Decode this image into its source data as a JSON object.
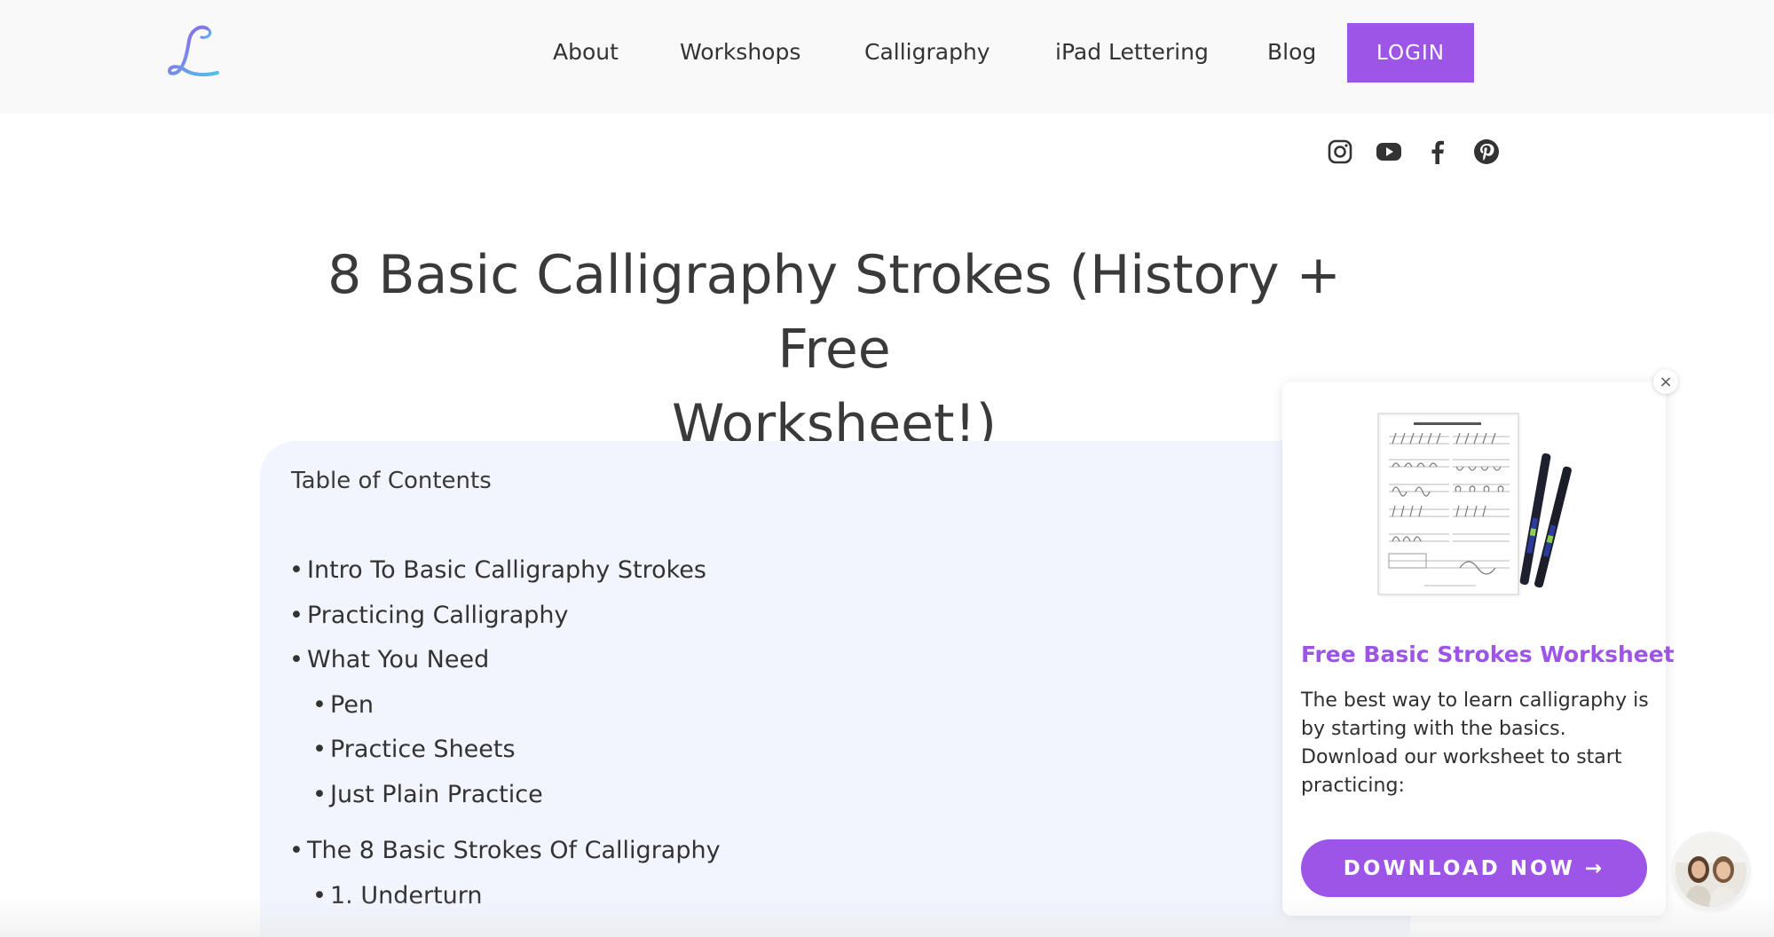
{
  "header": {
    "logo_letter": "L",
    "nav": [
      {
        "label": "About"
      },
      {
        "label": "Workshops"
      },
      {
        "label": "Calligraphy"
      },
      {
        "label": "iPad Lettering"
      },
      {
        "label": "Blog"
      }
    ],
    "login_label": "LOGIN"
  },
  "social": [
    {
      "icon": "instagram-icon"
    },
    {
      "icon": "youtube-icon"
    },
    {
      "icon": "facebook-icon"
    },
    {
      "icon": "pinterest-icon"
    }
  ],
  "article": {
    "title_line1": "8 Basic Calligraphy Strokes (History + Free",
    "title_line2": "Worksheet!)"
  },
  "toc": {
    "title": "Table of Contents",
    "items": [
      {
        "label": "Intro To Basic Calligraphy Strokes",
        "level": 1
      },
      {
        "label": "Practicing Calligraphy",
        "level": 1
      },
      {
        "label": "What You Need",
        "level": 1
      },
      {
        "label": "Pen",
        "level": 2
      },
      {
        "label": "Practice Sheets",
        "level": 2
      },
      {
        "label": "Just Plain Practice",
        "level": 2
      },
      {
        "label": "The 8 Basic Strokes Of Calligraphy",
        "level": 1
      },
      {
        "label": "1. Underturn",
        "level": 2
      }
    ]
  },
  "popup": {
    "close_label": "×",
    "heading": "Free Basic Strokes Worksheet",
    "text": "The best way to learn calligraphy is by starting with the basics. Download our worksheet to start practicing:",
    "button_label": "DOWNLOAD NOW →"
  },
  "colors": {
    "accent": "#9d55e8",
    "toc_background": "#f2f5fe",
    "header_background": "#f9f9fa"
  }
}
